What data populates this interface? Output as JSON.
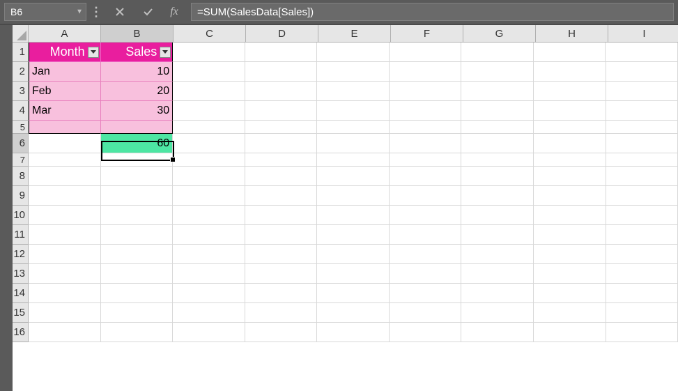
{
  "nameBox": "B6",
  "formulaBar": "=SUM(SalesData[Sales])",
  "fxLabel": "fx",
  "columns": [
    "A",
    "B",
    "C",
    "D",
    "E",
    "F",
    "G",
    "H",
    "I"
  ],
  "rows": [
    "1",
    "2",
    "3",
    "4",
    "5",
    "6",
    "7",
    "8",
    "9",
    "10",
    "11",
    "12",
    "13",
    "14",
    "15",
    "16"
  ],
  "table": {
    "headers": {
      "a": "Month",
      "b": "Sales"
    },
    "r2": {
      "a": "Jan",
      "b": "10"
    },
    "r3": {
      "a": "Feb",
      "b": "20"
    },
    "r4": {
      "a": "Mar",
      "b": "30"
    },
    "r5": {
      "a": "",
      "b": ""
    }
  },
  "result": "60",
  "selectedCell": "B6"
}
